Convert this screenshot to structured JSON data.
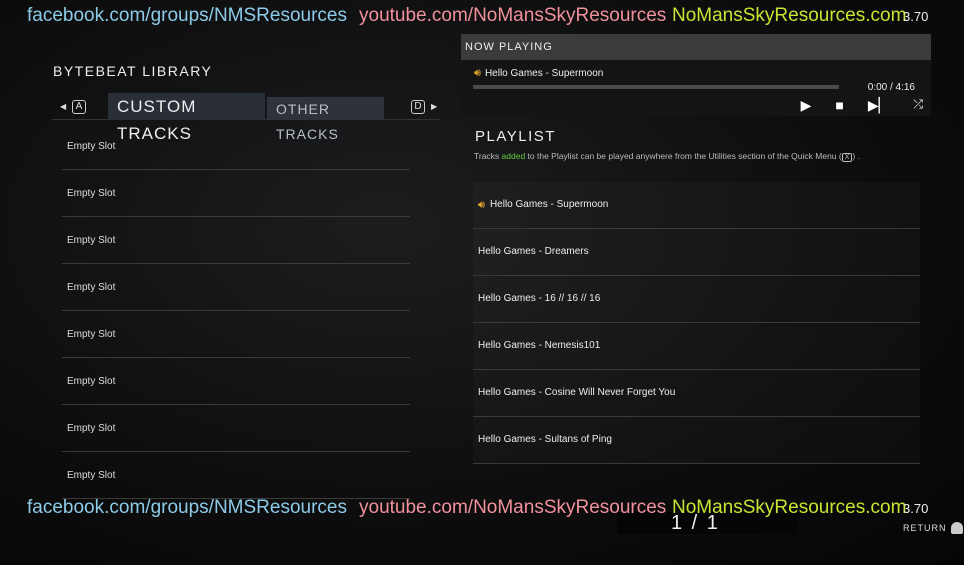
{
  "banner": {
    "facebook": "facebook.com/groups/NMSResources",
    "youtube": "youtube.com/NoMansSkyResources",
    "site": "NoMansSkyResources.com",
    "version": "3.70"
  },
  "library": {
    "title": "BYTEBEAT LIBRARY",
    "key_left": "A",
    "key_right": "D",
    "tabs": [
      {
        "label": "CUSTOM TRACKS"
      },
      {
        "label": "OTHER TRACKS"
      }
    ],
    "slots": [
      "Empty Slot",
      "Empty Slot",
      "Empty Slot",
      "Empty Slot",
      "Empty Slot",
      "Empty Slot",
      "Empty Slot",
      "Empty Slot"
    ]
  },
  "now_playing": {
    "header": "NOW PLAYING",
    "track": "Hello Games - Supermoon",
    "time": "0:00 /  4:16",
    "progress": 0
  },
  "playlist": {
    "title": "PLAYLIST",
    "note_pre": "Tracks ",
    "note_added": "added",
    "note_post": " to the Playlist can be played anywhere from the Utilities section of the Quick Menu (",
    "note_key": "X",
    "note_end": ") .",
    "items": [
      "Hello Games - Supermoon",
      "Hello Games - Dreamers",
      "Hello Games - 16 // 16 // 16",
      "Hello Games - Nemesis101",
      "Hello Games - Cosine Will Never Forget You",
      "Hello Games - Sultans of Ping"
    ]
  },
  "footer": {
    "page": "1 / 1",
    "return": "RETURN"
  },
  "colors": {
    "facebook": "#8ccbe8",
    "youtube": "#f0919c",
    "site": "#c7e431",
    "added": "#5fc93c",
    "speaker": "#f0b030"
  }
}
